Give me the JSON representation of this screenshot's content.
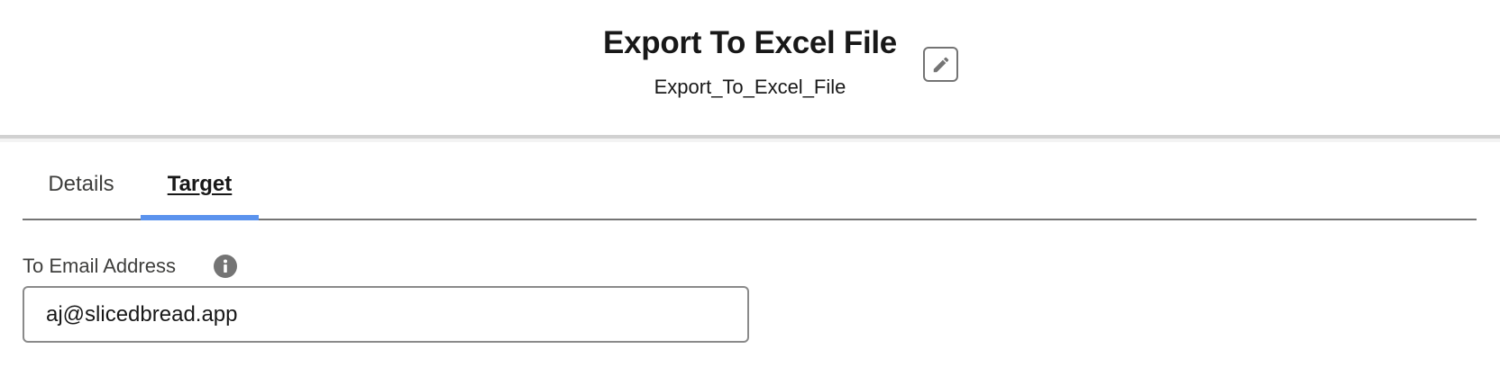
{
  "header": {
    "title": "Export To Excel File",
    "api_name": "Export_To_Excel_File",
    "edit_icon": "pencil-icon"
  },
  "tabs": [
    {
      "label": "Details",
      "active": false
    },
    {
      "label": "Target",
      "active": true
    }
  ],
  "form": {
    "to_email": {
      "label": "To Email Address",
      "info_icon": "info-icon",
      "value": "aj@slicedbread.app"
    }
  },
  "colors": {
    "active_tab_accent": "#5b93ee",
    "border": "#747474",
    "icon_gray": "#747474"
  }
}
